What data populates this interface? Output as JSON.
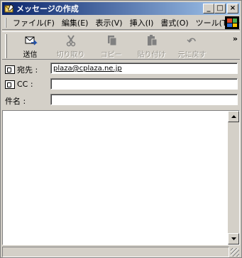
{
  "window": {
    "title": "メッセージの作成",
    "minimize_label": "_",
    "maximize_label": "□",
    "close_label": "×"
  },
  "menubar": {
    "items": [
      "ファイル(F)",
      "編集(E)",
      "表示(V)",
      "挿入(I)",
      "書式(O)",
      "ツール(T)"
    ],
    "more_label": "»",
    "logo_icon": "windows-logo-icon"
  },
  "toolbar": {
    "send": {
      "label": "送信",
      "icon": "send-icon"
    },
    "cut": {
      "label": "切り取り",
      "icon": "scissors-icon"
    },
    "copy": {
      "label": "コピー",
      "icon": "copy-icon"
    },
    "paste": {
      "label": "貼り付け",
      "icon": "paste-icon"
    },
    "undo": {
      "label": "元に戻す",
      "icon": "undo-icon"
    },
    "more_label": "»"
  },
  "fields": {
    "to": {
      "label": "宛先 :",
      "value": "plaza@cplaza.ne.jp"
    },
    "cc": {
      "label": "CC :",
      "value": ""
    },
    "subject": {
      "label": "件名 :",
      "value": ""
    }
  },
  "body": {
    "text": ""
  },
  "colors": {
    "titlebar_start": "#0a246a",
    "titlebar_end": "#a6caf0",
    "chrome": "#d4d0c8"
  }
}
